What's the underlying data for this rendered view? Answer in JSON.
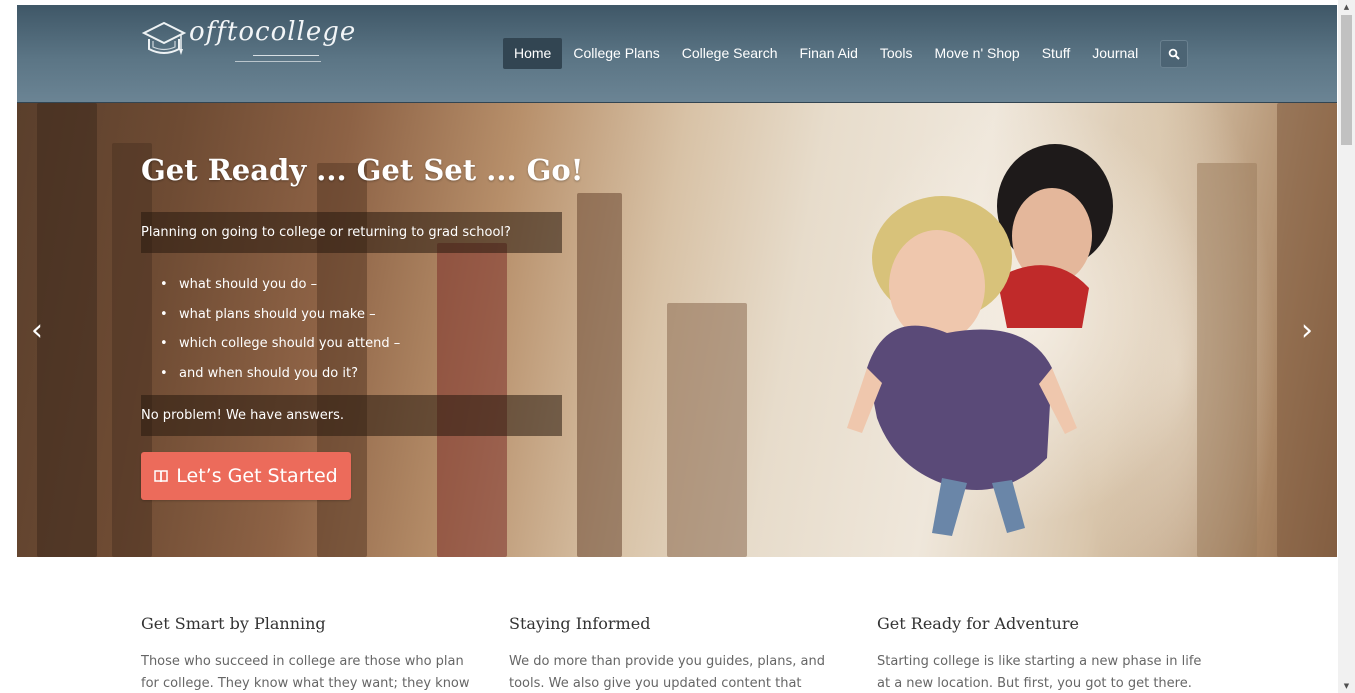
{
  "header": {
    "logo_text": "offtocollege",
    "nav": [
      {
        "label": "Home",
        "active": true
      },
      {
        "label": "College Plans",
        "active": false
      },
      {
        "label": "College Search",
        "active": false
      },
      {
        "label": "Finan Aid",
        "active": false
      },
      {
        "label": "Tools",
        "active": false
      },
      {
        "label": "Move n' Shop",
        "active": false
      },
      {
        "label": "Stuff",
        "active": false
      },
      {
        "label": "Journal",
        "active": false
      }
    ],
    "search_icon": "search-icon"
  },
  "hero": {
    "title": "Get Ready ... Get Set ... Go!",
    "intro": "Planning on going to college or returning to grad school?",
    "bullets": [
      "what should you do –",
      "what plans should you make –",
      "which college should you attend –",
      "and when should you do it?"
    ],
    "closing": "No problem! We have answers.",
    "cta_label": "Let’s Get Started",
    "cta_icon": "book-icon",
    "prev_icon": "chevron-left-icon",
    "next_icon": "chevron-right-icon",
    "prev_glyph": "‹",
    "next_glyph": "›"
  },
  "features": [
    {
      "title": "Get Smart by Planning",
      "text": "Those who succeed in college are those who plan for college. They know what they want; they know"
    },
    {
      "title": "Staying Informed",
      "text": "We do more than provide you guides, plans, and tools. We also give you updated content that"
    },
    {
      "title": "Get Ready for Adventure",
      "text": "Starting college is like starting a new phase in life at a new location. But first, you got to get there."
    }
  ],
  "colors": {
    "header_bg": "#5b7585",
    "cta_bg": "#ec6b5b",
    "nav_active_bg": "#324552"
  }
}
